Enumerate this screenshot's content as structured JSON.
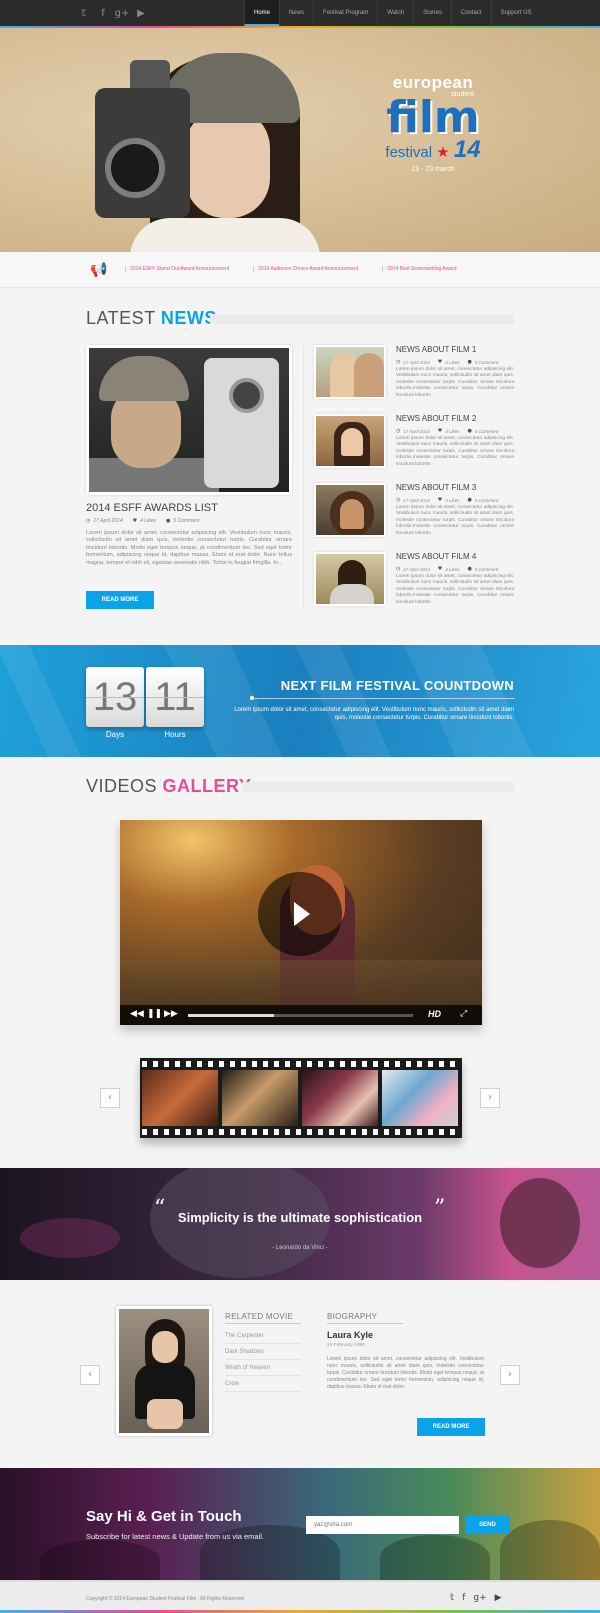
{
  "nav": {
    "social": [
      "t",
      "f",
      "g+",
      "▶"
    ],
    "items": [
      "Home",
      "News",
      "Festival Program",
      "Watch",
      "Stories",
      "Contact",
      "Support US"
    ]
  },
  "hero": {
    "logo_line1": "european",
    "logo_line2": "student",
    "logo_line3": "film",
    "logo_line4": "festival",
    "logo_number": "14",
    "logo_dates": "19 - 23 march"
  },
  "ticker": {
    "items": [
      "2014 ESFF Stand Out Award Announcement",
      "2014 Audience Choice Award Announcement",
      "2014 Best Screenwriting Award"
    ]
  },
  "latest": {
    "title_a": "LATEST",
    "title_b": "NEWS",
    "main": {
      "title": "2014 ESFF AWARDS LIST",
      "date": "17 April 2014",
      "likes": "4 Likes",
      "comments": "5 Comment",
      "text": "Lorem ipsum dolor sit amet, consectetur adipiscing elit. Vestibulum nunc mauris, sollicitudin sit amet diam quis, molestie consectetur turpis. Curabitur ornare tincidunt lobortis. Morbi eget tempus neque, at condimentum leo. Sed eget tortor fermentum, adipiscing neque id, dapibus massa. Etiam id erat dolor. Nunc tellus magna, tempor et nibh sit, egestas venenatis nibh. Tortor in feugiat fringilla. In...",
      "button": "READ MORE"
    },
    "side": [
      {
        "title": "NEWS ABOUT FILM 1",
        "date": "17 April 2014",
        "likes": "4 Likes",
        "comments": "5 Comment",
        "text": "Lorem ipsum dolor sit amet, consectetur adipiscing elit. Vestibulum nunc mauris, sollicitudin sit amet diam quis, molestie consectetur turpis. Curabitur ornare tincidunt lobortis.molestie consectetur turpis. Curabitur ornare tincidunt lobortis"
      },
      {
        "title": "NEWS ABOUT FILM 2",
        "date": "17 April 2014",
        "likes": "4 Likes",
        "comments": "5 Comment",
        "text": "Lorem ipsum dolor sit amet, consectetur adipiscing elit. Vestibulum nunc mauris, sollicitudin sit amet diam quis, molestie consectetur turpis. Curabitur ornare tincidunt lobortis.molestie consectetur turpis. Curabitur ornare tincidunt lobortis"
      },
      {
        "title": "NEWS ABOUT FILM 3",
        "date": "17 April 2014",
        "likes": "4 Likes",
        "comments": "5 Comment",
        "text": "Lorem ipsum dolor sit amet, consectetur adipiscing elit. Vestibulum nunc mauris, sollicitudin sit amet diam quis, molestie consectetur turpis. Curabitur ornare tincidunt lobortis.molestie consectetur turpis. Curabitur ornare tincidunt lobortis"
      },
      {
        "title": "NEWS ABOUT FILM 4",
        "date": "17 April 2014",
        "likes": "4 Likes",
        "comments": "5 Comment",
        "text": "Lorem ipsum dolor sit amet, consectetur adipiscing elit. Vestibulum nunc mauris, sollicitudin sit amet diam quis, molestie consectetur turpis. Curabitur ornare tincidunt lobortis.molestie consectetur turpis. Curabitur ornare tincidunt lobortis"
      }
    ]
  },
  "countdown": {
    "days": "13",
    "hours": "11",
    "days_label": "Days",
    "hours_label": "Hours",
    "title": "NEXT FILM FESTIVAL COUNTDOWN",
    "text": "Lorem ipsum dolor sit amet, consectetur adipiscing elit. Vestibulum nunc mauris, sollicitudin sit amet diam quis, molestie consectetur turpis. Curabitur ornare tincidunt lobortis."
  },
  "gallery": {
    "title_a": "VIDEOS",
    "title_b": "GALLERY",
    "hd_label": "HD",
    "progress": 0.38,
    "prev_icon": "chevron-left-icon",
    "next_icon": "chevron-right-icon"
  },
  "quote": {
    "open": "“",
    "close": "”",
    "text": "Simplicity is the ultimate sophistication",
    "author": "- Leonardo da Vinci -"
  },
  "related": {
    "movie_title": "RELATED MOVIE",
    "movies": [
      "The Carpenter",
      "Dark Shadows",
      "Wrath of Heaven",
      "Crow"
    ],
    "bio_title": "BIOGRAPHY",
    "name": "Laura Kyle",
    "date": "24 February 1990",
    "bio": "Lorem ipsum dolor sit amet, consectetur adipiscing elit. Vestibulum nunc mauris, sollicitudin sit amet diam quis, molestie consectetur turpis. Curabitur ornare tincidunt lobortis. Morbi eget tempus neque, at condimentum leo. Sed eget tortor fermentum, adipiscing neque id, dapibus massa. Etiam id erat dolor.",
    "button": "READ MORE"
  },
  "contact": {
    "title": "Say Hi & Get in Touch",
    "subtitle": "Subscribe for latest news & Update from us via email.",
    "placeholder": "yaz@sha.com",
    "button": "SEND"
  },
  "footer": {
    "copyright": "Copyright © 2014 European Student Festival Film . All Rights Reserved",
    "social": [
      "t",
      "f",
      "g+",
      "▶"
    ]
  },
  "colors": {
    "accent_blue": "#0aa3ea",
    "accent_pink": "#e44d9a",
    "topbar": "#2b2b2b"
  }
}
